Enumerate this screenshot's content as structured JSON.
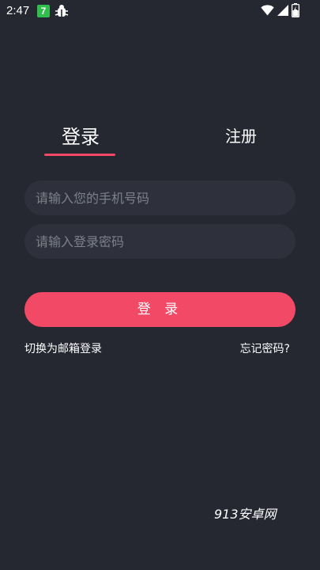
{
  "status_bar": {
    "time": "2:47",
    "notification_badge": "7"
  },
  "tabs": {
    "login_label": "登录",
    "register_label": "注册",
    "active_color": "#f24a66"
  },
  "form": {
    "phone_placeholder": "请输入您的手机号码",
    "password_placeholder": "请输入登录密码",
    "login_button_label": "登 录"
  },
  "links": {
    "switch_email": "切换为邮箱登录",
    "forgot_password": "忘记密码?"
  },
  "watermark": "913安卓网"
}
